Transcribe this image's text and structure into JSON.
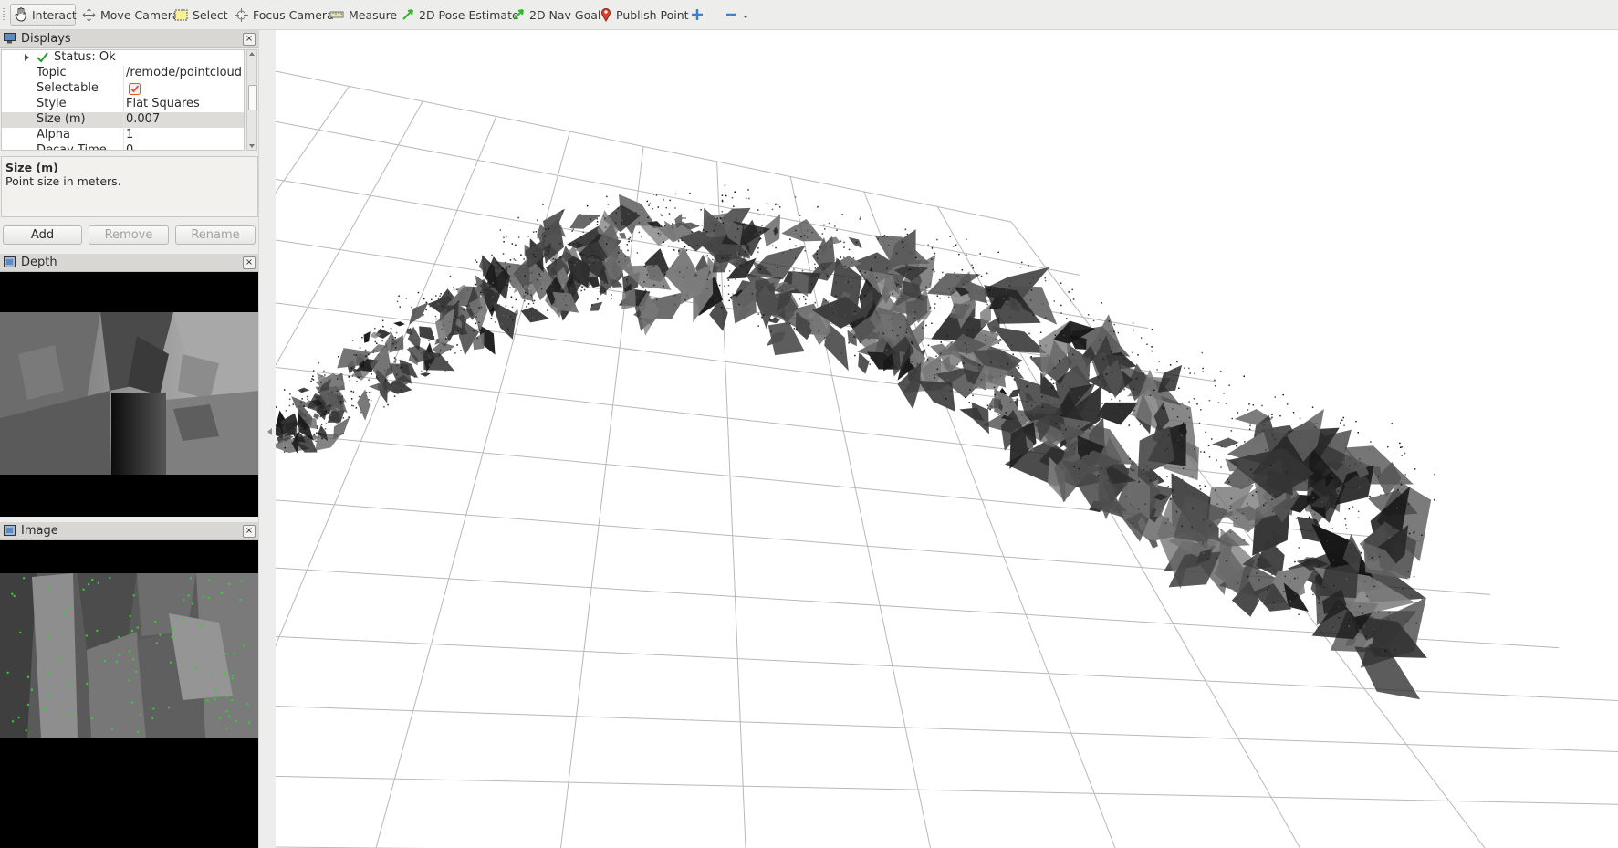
{
  "toolbar": {
    "tools": [
      {
        "label": "Interact",
        "icon": "hand-icon",
        "active": true
      },
      {
        "label": "Move Camera",
        "icon": "move-camera-icon"
      },
      {
        "label": "Select",
        "icon": "select-box-icon"
      },
      {
        "label": "Focus Camera",
        "icon": "crosshair-icon"
      },
      {
        "label": "Measure",
        "icon": "ruler-icon"
      },
      {
        "label": "2D Pose Estimate",
        "icon": "green-arrow-icon"
      },
      {
        "label": "2D Nav Goal",
        "icon": "green-arrow-icon"
      },
      {
        "label": "Publish Point",
        "icon": "map-pin-icon"
      }
    ]
  },
  "displays": {
    "title": "Displays",
    "rows": [
      {
        "key": "Status: Ok",
        "value": ""
      },
      {
        "key": "Topic",
        "value": "/remode/pointcloud"
      },
      {
        "key": "Selectable",
        "value": "",
        "checked": true
      },
      {
        "key": "Style",
        "value": "Flat Squares"
      },
      {
        "key": "Size (m)",
        "value": "0.007",
        "selected": true
      },
      {
        "key": "Alpha",
        "value": "1"
      },
      {
        "key": "Decay Time",
        "value": "0"
      }
    ],
    "description": {
      "title": "Size (m)",
      "text": "Point size in meters."
    },
    "buttons": {
      "add": "Add",
      "remove": "Remove",
      "rename": "Rename"
    }
  },
  "depth_panel": {
    "title": "Depth"
  },
  "image_panel": {
    "title": "Image"
  },
  "colors": {
    "status_ok": "#2e9c2e",
    "checkbox": "#e05a28",
    "feature_points": "#30d030"
  }
}
